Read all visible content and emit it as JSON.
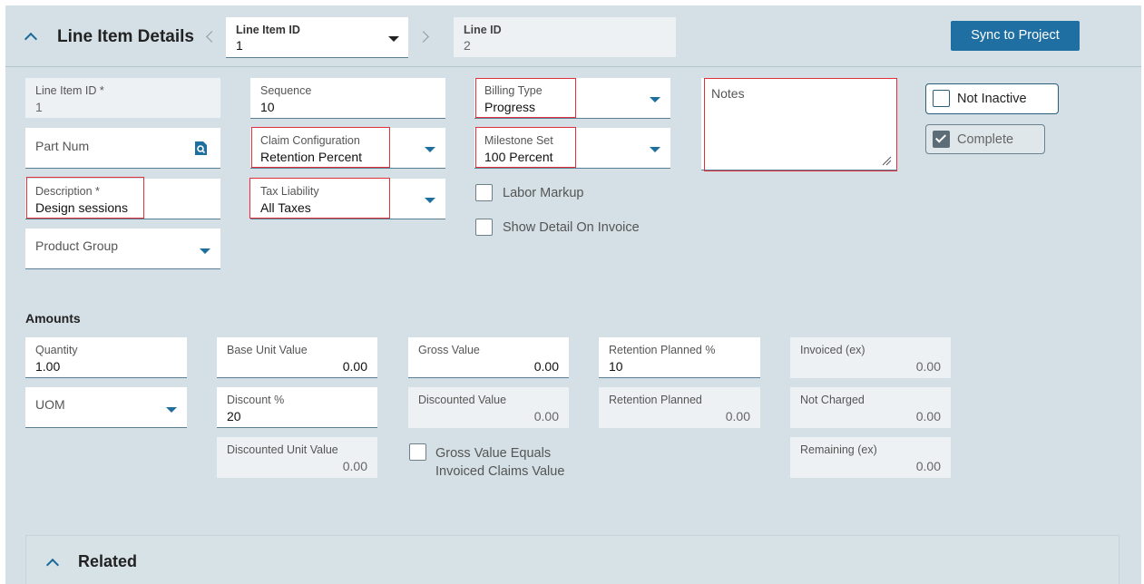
{
  "header": {
    "title": "Line Item Details",
    "line_item_selector": {
      "label": "Line Item ID",
      "value": "1"
    },
    "line_id": {
      "label": "Line ID",
      "value": "2"
    },
    "sync_button": "Sync to Project"
  },
  "details": {
    "line_item_id": {
      "label": "Line Item ID *",
      "value": "1"
    },
    "part_num": {
      "placeholder": "Part Num"
    },
    "description": {
      "label": "Description *",
      "value": "Design sessions"
    },
    "product_group": {
      "placeholder": "Product Group"
    },
    "sequence": {
      "label": "Sequence",
      "value": "10"
    },
    "claim_configuration": {
      "label": "Claim Configuration",
      "value": "Retention Percent"
    },
    "tax_liability": {
      "label": "Tax Liability",
      "value": "All Taxes"
    },
    "billing_type": {
      "label": "Billing Type",
      "value": "Progress"
    },
    "milestone_set": {
      "label": "Milestone Set",
      "value": "100 Percent"
    },
    "labor_markup": "Labor Markup",
    "show_detail_on_invoice": "Show Detail On Invoice",
    "notes": {
      "placeholder": "Notes"
    },
    "not_inactive": "Not Inactive",
    "complete": "Complete"
  },
  "amounts": {
    "heading": "Amounts",
    "quantity": {
      "label": "Quantity",
      "value": "1.00"
    },
    "uom": {
      "placeholder": "UOM"
    },
    "base_unit_value": {
      "label": "Base Unit Value",
      "value": "0.00"
    },
    "discount_pct": {
      "label": "Discount %",
      "value": "20"
    },
    "discounted_unit_value": {
      "label": "Discounted Unit Value",
      "value": "0.00"
    },
    "gross_value": {
      "label": "Gross Value",
      "value": "0.00"
    },
    "discounted_value": {
      "label": "Discounted Value",
      "value": "0.00"
    },
    "gross_equals_invoiced": "Gross Value Equals Invoiced Claims Value",
    "retention_planned_pct": {
      "label": "Retention Planned %",
      "value": "10"
    },
    "retention_planned": {
      "label": "Retention Planned",
      "value": "0.00"
    },
    "invoiced_ex": {
      "label": "Invoiced (ex)",
      "value": "0.00"
    },
    "not_charged": {
      "label": "Not Charged",
      "value": "0.00"
    },
    "remaining_ex": {
      "label": "Remaining (ex)",
      "value": "0.00"
    }
  },
  "related": {
    "title": "Related"
  },
  "icons": {
    "collapse": "chevron-up-icon",
    "prev": "chevron-left-icon",
    "next": "chevron-right-icon",
    "dropdown": "caret-down-icon",
    "search": "search-icon"
  },
  "colors": {
    "panel_bg": "#d4e0e5",
    "accent": "#1f6fa3",
    "highlight": "#e0303a"
  }
}
